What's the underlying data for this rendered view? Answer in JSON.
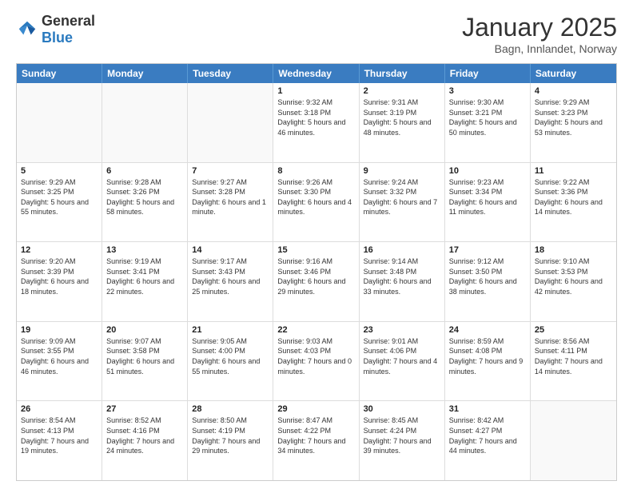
{
  "logo": {
    "general": "General",
    "blue": "Blue"
  },
  "title": {
    "month": "January 2025",
    "location": "Bagn, Innlandet, Norway"
  },
  "header_days": [
    "Sunday",
    "Monday",
    "Tuesday",
    "Wednesday",
    "Thursday",
    "Friday",
    "Saturday"
  ],
  "weeks": [
    [
      {
        "day": "",
        "content": ""
      },
      {
        "day": "",
        "content": ""
      },
      {
        "day": "",
        "content": ""
      },
      {
        "day": "1",
        "content": "Sunrise: 9:32 AM\nSunset: 3:18 PM\nDaylight: 5 hours and 46 minutes."
      },
      {
        "day": "2",
        "content": "Sunrise: 9:31 AM\nSunset: 3:19 PM\nDaylight: 5 hours and 48 minutes."
      },
      {
        "day": "3",
        "content": "Sunrise: 9:30 AM\nSunset: 3:21 PM\nDaylight: 5 hours and 50 minutes."
      },
      {
        "day": "4",
        "content": "Sunrise: 9:29 AM\nSunset: 3:23 PM\nDaylight: 5 hours and 53 minutes."
      }
    ],
    [
      {
        "day": "5",
        "content": "Sunrise: 9:29 AM\nSunset: 3:25 PM\nDaylight: 5 hours and 55 minutes."
      },
      {
        "day": "6",
        "content": "Sunrise: 9:28 AM\nSunset: 3:26 PM\nDaylight: 5 hours and 58 minutes."
      },
      {
        "day": "7",
        "content": "Sunrise: 9:27 AM\nSunset: 3:28 PM\nDaylight: 6 hours and 1 minute."
      },
      {
        "day": "8",
        "content": "Sunrise: 9:26 AM\nSunset: 3:30 PM\nDaylight: 6 hours and 4 minutes."
      },
      {
        "day": "9",
        "content": "Sunrise: 9:24 AM\nSunset: 3:32 PM\nDaylight: 6 hours and 7 minutes."
      },
      {
        "day": "10",
        "content": "Sunrise: 9:23 AM\nSunset: 3:34 PM\nDaylight: 6 hours and 11 minutes."
      },
      {
        "day": "11",
        "content": "Sunrise: 9:22 AM\nSunset: 3:36 PM\nDaylight: 6 hours and 14 minutes."
      }
    ],
    [
      {
        "day": "12",
        "content": "Sunrise: 9:20 AM\nSunset: 3:39 PM\nDaylight: 6 hours and 18 minutes."
      },
      {
        "day": "13",
        "content": "Sunrise: 9:19 AM\nSunset: 3:41 PM\nDaylight: 6 hours and 22 minutes."
      },
      {
        "day": "14",
        "content": "Sunrise: 9:17 AM\nSunset: 3:43 PM\nDaylight: 6 hours and 25 minutes."
      },
      {
        "day": "15",
        "content": "Sunrise: 9:16 AM\nSunset: 3:46 PM\nDaylight: 6 hours and 29 minutes."
      },
      {
        "day": "16",
        "content": "Sunrise: 9:14 AM\nSunset: 3:48 PM\nDaylight: 6 hours and 33 minutes."
      },
      {
        "day": "17",
        "content": "Sunrise: 9:12 AM\nSunset: 3:50 PM\nDaylight: 6 hours and 38 minutes."
      },
      {
        "day": "18",
        "content": "Sunrise: 9:10 AM\nSunset: 3:53 PM\nDaylight: 6 hours and 42 minutes."
      }
    ],
    [
      {
        "day": "19",
        "content": "Sunrise: 9:09 AM\nSunset: 3:55 PM\nDaylight: 6 hours and 46 minutes."
      },
      {
        "day": "20",
        "content": "Sunrise: 9:07 AM\nSunset: 3:58 PM\nDaylight: 6 hours and 51 minutes."
      },
      {
        "day": "21",
        "content": "Sunrise: 9:05 AM\nSunset: 4:00 PM\nDaylight: 6 hours and 55 minutes."
      },
      {
        "day": "22",
        "content": "Sunrise: 9:03 AM\nSunset: 4:03 PM\nDaylight: 7 hours and 0 minutes."
      },
      {
        "day": "23",
        "content": "Sunrise: 9:01 AM\nSunset: 4:06 PM\nDaylight: 7 hours and 4 minutes."
      },
      {
        "day": "24",
        "content": "Sunrise: 8:59 AM\nSunset: 4:08 PM\nDaylight: 7 hours and 9 minutes."
      },
      {
        "day": "25",
        "content": "Sunrise: 8:56 AM\nSunset: 4:11 PM\nDaylight: 7 hours and 14 minutes."
      }
    ],
    [
      {
        "day": "26",
        "content": "Sunrise: 8:54 AM\nSunset: 4:13 PM\nDaylight: 7 hours and 19 minutes."
      },
      {
        "day": "27",
        "content": "Sunrise: 8:52 AM\nSunset: 4:16 PM\nDaylight: 7 hours and 24 minutes."
      },
      {
        "day": "28",
        "content": "Sunrise: 8:50 AM\nSunset: 4:19 PM\nDaylight: 7 hours and 29 minutes."
      },
      {
        "day": "29",
        "content": "Sunrise: 8:47 AM\nSunset: 4:22 PM\nDaylight: 7 hours and 34 minutes."
      },
      {
        "day": "30",
        "content": "Sunrise: 8:45 AM\nSunset: 4:24 PM\nDaylight: 7 hours and 39 minutes."
      },
      {
        "day": "31",
        "content": "Sunrise: 8:42 AM\nSunset: 4:27 PM\nDaylight: 7 hours and 44 minutes."
      },
      {
        "day": "",
        "content": ""
      }
    ]
  ]
}
